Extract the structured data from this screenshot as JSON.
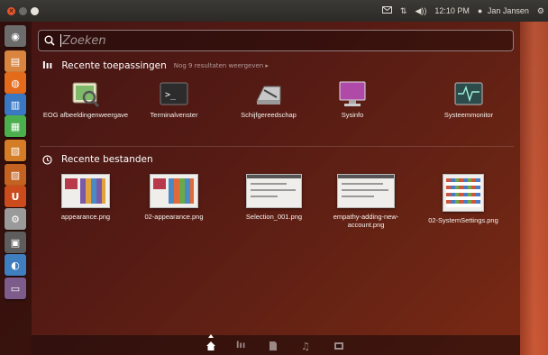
{
  "topbar": {
    "indicators": {
      "time": "12:10 PM",
      "user": "Jan Jansen"
    }
  },
  "launcher": {
    "items": [
      {
        "icon": "dash-home-icon",
        "color": "#6c6c6c"
      },
      {
        "icon": "files-icon",
        "color": "#d9843f"
      },
      {
        "icon": "firefox-icon",
        "color": "#e46a1c"
      },
      {
        "icon": "writer-icon",
        "color": "#3a78c4"
      },
      {
        "icon": "calc-icon",
        "color": "#4caf4e"
      },
      {
        "icon": "impress-icon",
        "color": "#d47d26"
      },
      {
        "icon": "software-center-icon",
        "color": "#c46222"
      },
      {
        "icon": "ubuntu-one-icon",
        "color": "#cc4b1c"
      },
      {
        "icon": "system-settings-icon",
        "color": "#9a9a9a"
      },
      {
        "icon": "workspace-switcher-icon",
        "color": "#5d5d5d"
      },
      {
        "icon": "trash-icon",
        "color": "#3f7fc0"
      },
      {
        "icon": "terminal-icon",
        "color": "#7d5b8a"
      }
    ]
  },
  "search": {
    "placeholder": "Zoeken"
  },
  "recent_apps": {
    "title": "Recente toepassingen",
    "more": "Nog 9 resultaten weergeven",
    "items": [
      {
        "label": "EOG afbeeldingenweergave",
        "icon": "image-viewer-icon"
      },
      {
        "label": "Terminalvenster",
        "icon": "terminal-icon"
      },
      {
        "label": "Schijfgereedschap",
        "icon": "disk-utility-icon"
      },
      {
        "label": "Sysinfo",
        "icon": "sysinfo-icon"
      },
      {
        "label": "Systeemmonitor",
        "icon": "system-monitor-icon"
      }
    ]
  },
  "recent_files": {
    "title": "Recente bestanden",
    "items": [
      {
        "label": "appearance.png"
      },
      {
        "label": "02-appearance.png"
      },
      {
        "label": "Selection_001.png"
      },
      {
        "label": "empathy-adding-new-account.png"
      },
      {
        "label": "02-SystemSettings.png"
      }
    ]
  },
  "filters": [
    {
      "icon": "home-lens-icon"
    },
    {
      "icon": "applications-lens-icon"
    },
    {
      "icon": "files-lens-icon"
    },
    {
      "icon": "music-lens-icon"
    },
    {
      "icon": "video-lens-icon"
    }
  ]
}
